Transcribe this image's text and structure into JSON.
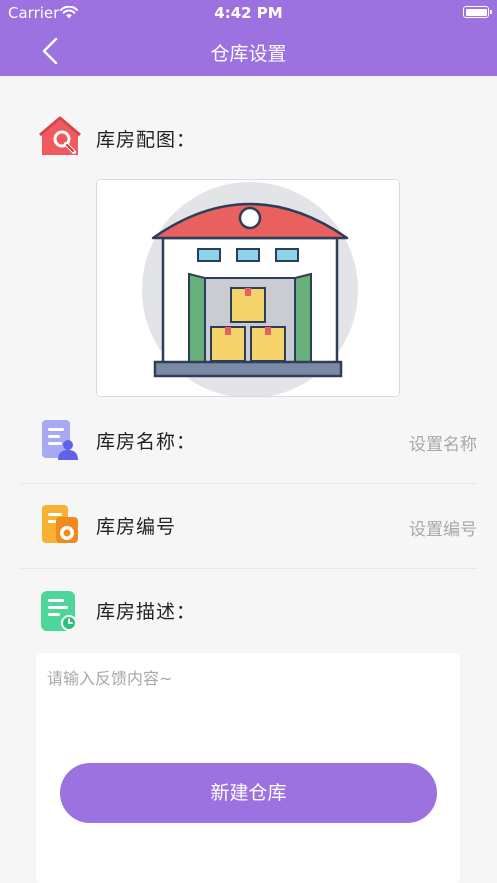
{
  "status_bar": {
    "carrier": "Carrier",
    "time": "4:42 PM"
  },
  "nav": {
    "title": "仓库设置",
    "back_icon": "chevron-left-icon"
  },
  "colors": {
    "accent": "#9b72e0",
    "placeholder": "#a8a8a8"
  },
  "form": {
    "map": {
      "label": "库房配图：",
      "icon": "warehouse-tool-icon",
      "image": "warehouse-illustration"
    },
    "name": {
      "label": "库房名称：",
      "icon": "document-person-icon",
      "placeholder": "设置名称"
    },
    "number": {
      "label": "库房编号",
      "icon": "document-gear-icon",
      "placeholder": "设置编号"
    },
    "description": {
      "label": "库房描述：",
      "icon": "document-clock-icon",
      "placeholder": "请输入反馈内容~"
    }
  },
  "submit_button": {
    "label": "新建仓库"
  }
}
